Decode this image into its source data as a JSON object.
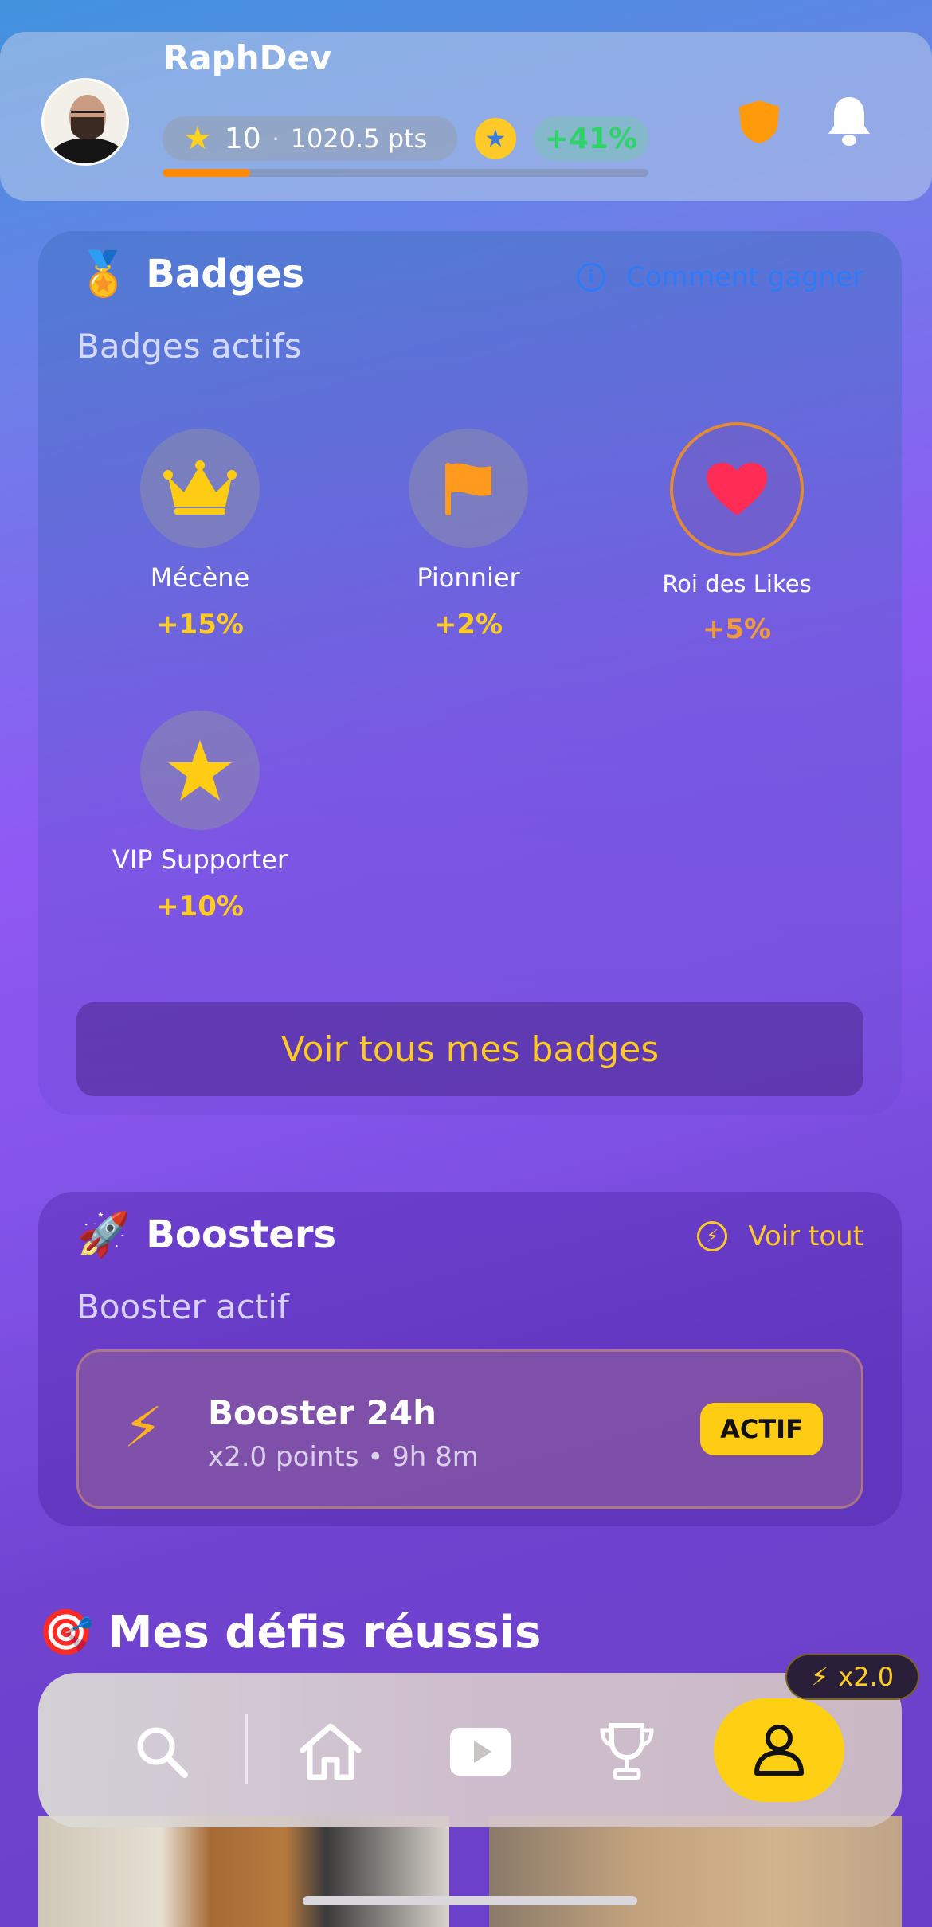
{
  "header": {
    "username": "RaphDev",
    "level": "10",
    "separator": "·",
    "points": "1020.5 pts",
    "growth": "+41%",
    "progress_percent": 18
  },
  "badges": {
    "title": "Badges",
    "how_to_earn": "Comment gagner",
    "subtitle": "Badges actifs",
    "items": [
      {
        "icon": "crown-icon",
        "name": "Mécène",
        "bonus": "+15%"
      },
      {
        "icon": "flag-icon",
        "name": "Pionnier",
        "bonus": "+2%"
      },
      {
        "icon": "heart-icon",
        "name": "Roi des Likes",
        "bonus": "+5%"
      },
      {
        "icon": "star-icon",
        "name": "VIP Supporter",
        "bonus": "+10%"
      }
    ],
    "see_all": "Voir tous mes badges"
  },
  "boosters": {
    "title": "Boosters",
    "see_all": "Voir tout",
    "subtitle": "Booster actif",
    "active": {
      "name": "Booster 24h",
      "meta": "x2.0 points • 9h 8m",
      "status": "ACTIF"
    }
  },
  "challenges": {
    "title": "Mes défis réussis"
  },
  "nav": {
    "multiplier": "x2.0",
    "items": [
      "search-icon",
      "home-icon",
      "video-icon",
      "trophy-icon",
      "profile-icon"
    ]
  },
  "colors": {
    "accent_yellow": "#ffcc14",
    "link_blue": "#2f7bf5",
    "success_green": "#2ed36a",
    "progress_orange": "#ff8a0a",
    "heart_red": "#ff2d55"
  }
}
